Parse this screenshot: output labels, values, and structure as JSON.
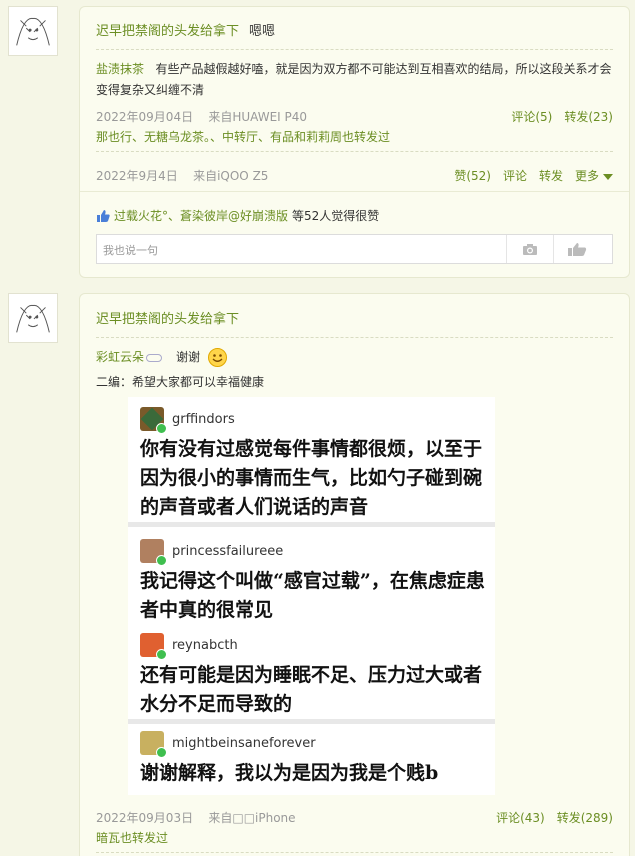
{
  "feed": [
    {
      "author": "迟早把禁阁的头发给拿下",
      "message": "嗯嗯",
      "quote": {
        "user": "盐渍抹茶",
        "text": "有些产品越假越好嗑，就是因为双方都不可能达到互相喜欢的结局，所以这段关系才会变得复杂又纠缠不清",
        "date": "2022年09月04日",
        "source": "来自HUAWEI P40",
        "comment_label": "评论(5)",
        "repost_label": "转发(23)",
        "reposters": "那也行、无糖乌龙茶。、中转厅、有品和莉莉周也转发过"
      },
      "date": "2022年9月4日",
      "source": "来自iQOO Z5",
      "like_label": "赞(52)",
      "comment_label": "评论",
      "repost_label": "转发",
      "more_label": "更多",
      "likers": "过载火花°、蒼染彼岸@好崩溃版",
      "likes_suffix": "等52人觉得很赞",
      "comment_placeholder": "我也说一句"
    },
    {
      "author": "迟早把禁阁的头发给拿下",
      "quote": {
        "user": "彩虹云朵",
        "message": "谢谢",
        "edit_note": "二编：希望大家都可以幸福健康",
        "date": "2022年09月03日",
        "source": "来自□□iPhone",
        "comment_label": "评论(43)",
        "repost_label": "转发(289)",
        "reposters": "暗瓦也转发过"
      }
    }
  ],
  "image_posts": [
    {
      "name": "grffindors",
      "text": "你有没有过感觉每件事情都很烦，以至于因为很小的事情而生气，比如勺子碰到碗的声音或者人们说话的声音"
    },
    {
      "name": "princessfailureee",
      "text": "我记得这个叫做“感官过载”，在焦虑症患者中真的很常见"
    },
    {
      "name": "reynabcth",
      "text": "还有可能是因为睡眠不足、压力过大或者水分不足而导致的"
    },
    {
      "name": "mightbeinsaneforever",
      "text": "谢谢解释，我以为是因为我是个贱b"
    }
  ],
  "colors": {
    "link": "#6b8e23",
    "background": "#f5f6e6"
  },
  "icons": [
    "thumbs-up-icon",
    "camera-icon",
    "like-hand-icon",
    "cloud-icon",
    "smile-emoji-icon",
    "chevron-down-icon",
    "repost-badge-icon"
  ]
}
